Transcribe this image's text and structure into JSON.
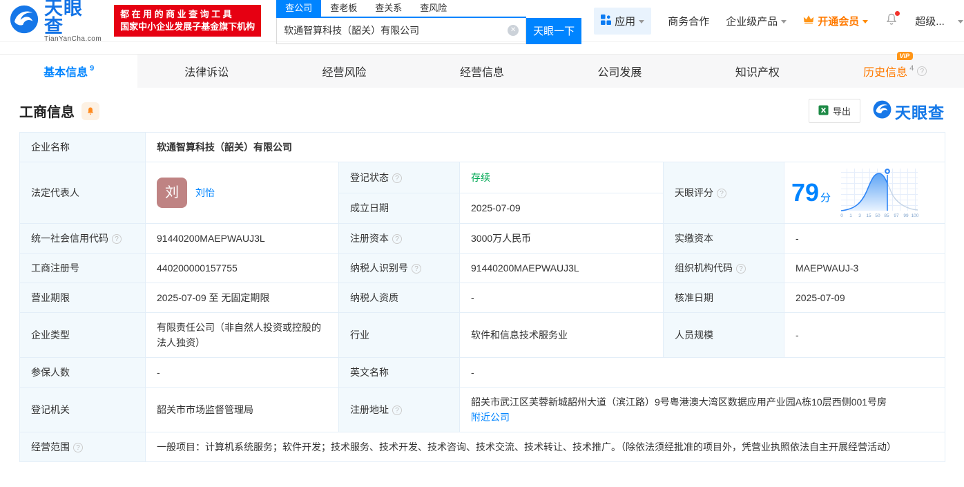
{
  "header": {
    "brand": "天眼查",
    "brand_domain": "TianYanCha.com",
    "slogan_line1": "都在用的商业查询工具",
    "slogan_line2": "国家中小企业发展子基金旗下机构",
    "search": {
      "tabs": [
        {
          "label": "查公司",
          "active": true
        },
        {
          "label": "查老板",
          "active": false
        },
        {
          "label": "查关系",
          "active": false
        },
        {
          "label": "查风险",
          "active": false
        }
      ],
      "value": "软通智算科技（韶关）有限公司",
      "button_label": "天眼一下"
    },
    "nav": {
      "apps": "应用",
      "cooperation": "商务合作",
      "enterprise": "企业级产品",
      "vip": "开通会员",
      "user": "超级..."
    }
  },
  "tabs": [
    {
      "label": "基本信息",
      "count": "9",
      "active": true
    },
    {
      "label": "法律诉讼"
    },
    {
      "label": "经营风险"
    },
    {
      "label": "经营信息"
    },
    {
      "label": "公司发展"
    },
    {
      "label": "知识产权"
    },
    {
      "label": "历史信息",
      "count": "4",
      "vip": true
    }
  ],
  "section": {
    "title": "工商信息",
    "export_label": "导出",
    "watermark_brand": "天眼查"
  },
  "company": {
    "name_label": "企业名称",
    "name": "软通智算科技（韶关）有限公司",
    "legal_rep_label": "法定代表人",
    "legal_rep_avatar": "刘",
    "legal_rep": "刘怡",
    "reg_status_label": "登记状态",
    "reg_status": "存续",
    "establish_date_label": "成立日期",
    "establish_date": "2025-07-09",
    "score_label": "天眼评分",
    "credit_code_label": "统一社会信用代码",
    "credit_code": "91440200MAEPWAUJ3L",
    "reg_capital_label": "注册资本",
    "reg_capital": "3000万人民币",
    "paid_capital_label": "实缴资本",
    "paid_capital": "-",
    "reg_number_label": "工商注册号",
    "reg_number": "440200000157755",
    "taxpayer_id_label": "纳税人识别号",
    "taxpayer_id": "91440200MAEPWAUJ3L",
    "org_code_label": "组织机构代码",
    "org_code": "MAEPWAUJ-3",
    "business_term_label": "营业期限",
    "business_term": "2025-07-09 至 无固定期限",
    "taxpayer_quality_label": "纳税人资质",
    "taxpayer_quality": "-",
    "approval_date_label": "核准日期",
    "approval_date": "2025-07-09",
    "company_type_label": "企业类型",
    "company_type": "有限责任公司（非自然人投资或控股的法人独资）",
    "industry_label": "行业",
    "industry": "软件和信息技术服务业",
    "staff_size_label": "人员规模",
    "staff_size": "-",
    "insured_label": "参保人数",
    "insured": "-",
    "english_name_label": "英文名称",
    "english_name": "-",
    "reg_authority_label": "登记机关",
    "reg_authority": "韶关市市场监督管理局",
    "address_label": "注册地址",
    "address": "韶关市武江区芙蓉新城韶州大道（滨江路）9号粤港澳大湾区数据应用产业园A栋10层西侧001号房",
    "nearby_link": "附近公司",
    "business_scope_label": "经营范围",
    "business_scope": "一般项目：计算机系统服务；软件开发；技术服务、技术开发、技术咨询、技术交流、技术转让、技术推广。（除依法须经批准的项目外，凭营业执照依法自主开展经营活动）"
  },
  "score_chart": {
    "type": "area",
    "score": "79",
    "unit": "分",
    "x_labels": [
      "0",
      "1",
      "3",
      "15",
      "50",
      "85",
      "97",
      "99",
      "100"
    ]
  },
  "icons": {
    "question": "?",
    "clear": "✕",
    "vip_badge": "VIP"
  },
  "colors": {
    "primary_blue": "#0084ff",
    "brand_red": "#e60012",
    "vip_orange": "#ff7a00",
    "status_green": "#00a854",
    "label_cell_bg": "#f2f9fd",
    "avatar_bg": "#bf8383"
  }
}
